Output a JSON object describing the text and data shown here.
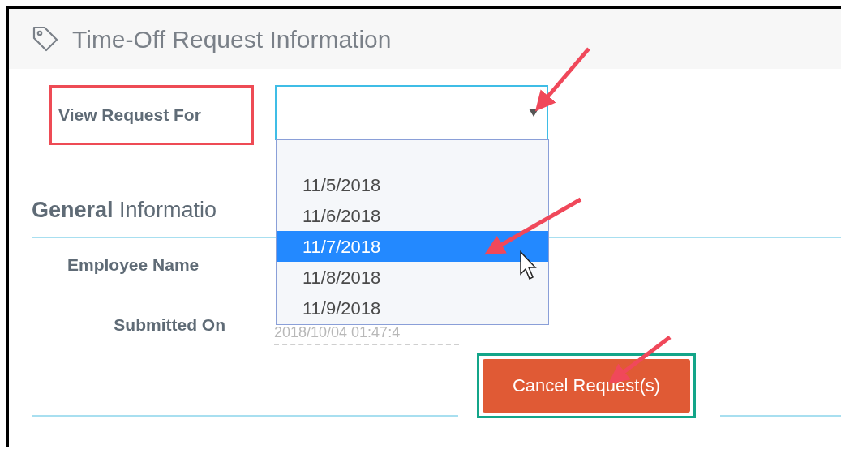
{
  "panel": {
    "title": "Time-Off Request Information"
  },
  "view_request_for": {
    "label": "View Request For",
    "highlighted": true,
    "open": true,
    "options": [
      {
        "label": "11/5/2018",
        "selected": false
      },
      {
        "label": "11/6/2018",
        "selected": false
      },
      {
        "label": "11/7/2018",
        "selected": true
      },
      {
        "label": "11/8/2018",
        "selected": false
      },
      {
        "label": "11/9/2018",
        "selected": false
      }
    ]
  },
  "section": {
    "title": "**General** Informatio"
  },
  "fields": [
    {
      "label": "Employee Name"
    },
    {
      "label": "Submitted On",
      "value": "2018/10/04 01:47:4"
    }
  ],
  "cancel_button": {
    "label": "Cancel Request(s)",
    "highlighted": true
  }
}
